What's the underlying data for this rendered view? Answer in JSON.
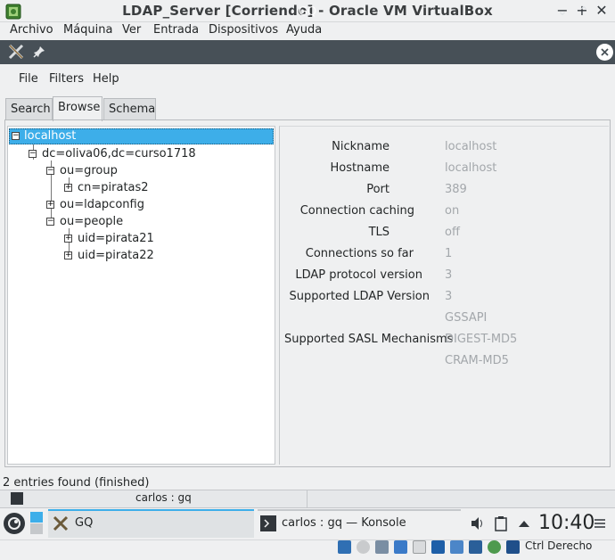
{
  "vbox": {
    "window_title": "LDAP_Server [Corriendo] - Oracle VM VirtualBox",
    "menu": [
      "Archivo",
      "Máquina",
      "Ver",
      "Entrada",
      "Dispositivos",
      "Ayuda"
    ],
    "host_key": "Ctrl Derecho"
  },
  "gq_window": {
    "title": "GQ"
  },
  "gq": {
    "menu": [
      "File",
      "Filters",
      "Help"
    ],
    "tabs": [
      "Search",
      "Browse",
      "Schema"
    ],
    "active_tab": "Browse",
    "tree": [
      {
        "label": "localhost",
        "toggle": "−"
      },
      {
        "label": "dc=oliva06,dc=curso1718",
        "toggle": "−"
      },
      {
        "label": "ou=group",
        "toggle": "−"
      },
      {
        "label": "cn=piratas2",
        "toggle": "+"
      },
      {
        "label": "ou=ldapconfig",
        "toggle": "+"
      },
      {
        "label": "ou=people",
        "toggle": "−"
      },
      {
        "label": "uid=pirata21",
        "toggle": "+"
      },
      {
        "label": "uid=pirata22",
        "toggle": "+"
      }
    ],
    "details": {
      "nickname_label": "Nickname",
      "nickname_value": "localhost",
      "hostname_label": "Hostname",
      "hostname_value": "localhost",
      "port_label": "Port",
      "port_value": "389",
      "caching_label": "Connection caching",
      "caching_value": "on",
      "tls_label": "TLS",
      "tls_value": "off",
      "connections_label": "Connections so far",
      "connections_value": "1",
      "protocol_label": "LDAP protocol version",
      "protocol_value": "3",
      "supported_label": "Supported LDAP Version",
      "supported_value": "3",
      "sasl_label": "Supported SASL Mechanisms",
      "sasl_values": [
        "GSSAPI",
        "DIGEST-MD5",
        "CRAM-MD5"
      ]
    },
    "status": "2 entries found (finished)"
  },
  "background_window": {
    "title": "carlos : gq"
  },
  "taskbar": {
    "task_gq": "GQ",
    "task_konsole": "carlos : gq — Konsole",
    "clock": "10:40"
  }
}
